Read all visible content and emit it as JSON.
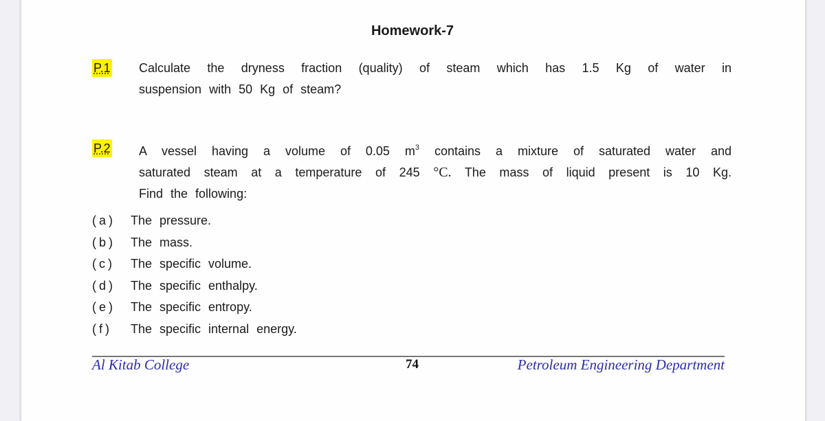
{
  "document": {
    "title": "Homework-7",
    "problems": [
      {
        "label": "P.1",
        "lines": [
          "Calculate the dryness fraction (quality) of steam which has 1.5 Kg of water in",
          "suspension with 50 Kg of steam?"
        ]
      },
      {
        "label": "P.2",
        "line1_pre": "A vessel having a volume of 0.05 m",
        "line1_sup": "3",
        "line1_post": "contains a mixture of saturated water and",
        "line2_pre": "saturated steam at a temperature of 245",
        "line2_deg": "°C.",
        "line2_post": "The mass of liquid present is 10 Kg.",
        "line3": "Find the following:",
        "items": [
          {
            "letter": "(a)",
            "text": "The pressure."
          },
          {
            "letter": "(b)",
            "text": "The mass."
          },
          {
            "letter": "(c)",
            "text": "The specific volume."
          },
          {
            "letter": "(d)",
            "text": "The specific enthalpy."
          },
          {
            "letter": "(e)",
            "text": "The specific entropy."
          },
          {
            "letter": "(f)",
            "text": "The specific internal energy."
          }
        ]
      }
    ],
    "footer": {
      "left": "Al Kitab College",
      "page_number": "74",
      "right": "Petroleum Engineering Department"
    },
    "colors": {
      "highlight": "#fff200",
      "footer_text": "#2b2bb5"
    }
  }
}
